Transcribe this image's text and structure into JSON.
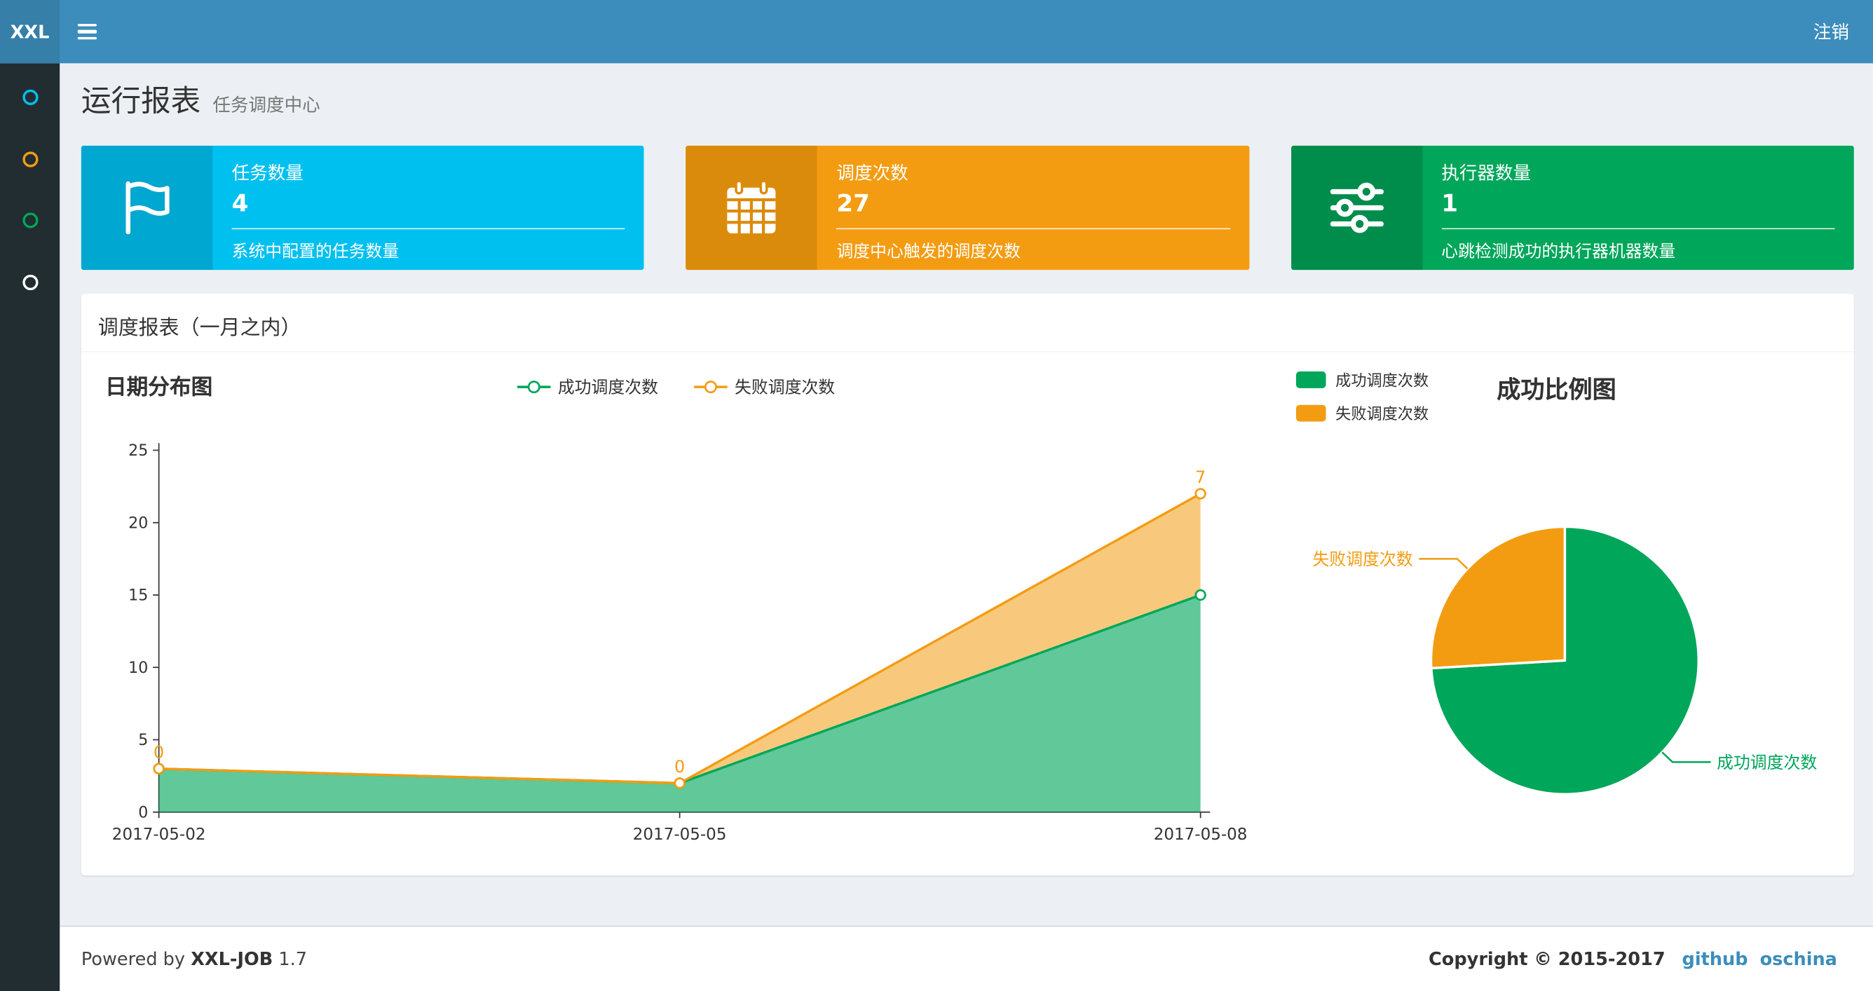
{
  "navbar": {
    "logo": "XXL",
    "menu_icon": "hamburger-icon",
    "logout": "注销"
  },
  "sidebar": {
    "items": [
      {
        "icon": "circle-outline-icon",
        "color": "#00c0ef"
      },
      {
        "icon": "circle-outline-icon",
        "color": "#f39c12"
      },
      {
        "icon": "circle-outline-icon",
        "color": "#00a65a"
      },
      {
        "icon": "circle-outline-icon",
        "color": "#ffffff"
      }
    ]
  },
  "page": {
    "title": "运行报表",
    "subtitle": "任务调度中心"
  },
  "stats": [
    {
      "label": "任务数量",
      "value": "4",
      "desc": "系统中配置的任务数量",
      "bg": "#00c0ef",
      "icon_bg": "#00a7d0",
      "icon": "flag-icon"
    },
    {
      "label": "调度次数",
      "value": "27",
      "desc": "调度中心触发的调度次数",
      "bg": "#f39c12",
      "icon_bg": "#db8b0b",
      "icon": "calendar-icon"
    },
    {
      "label": "执行器数量",
      "value": "1",
      "desc": "心跳检测成功的执行器机器数量",
      "bg": "#00a65a",
      "icon_bg": "#008d4c",
      "icon": "sliders-icon"
    }
  ],
  "panel": {
    "title": "调度报表（一月之内）"
  },
  "chart_data": [
    {
      "type": "area",
      "title": "日期分布图",
      "categories": [
        "2017-05-02",
        "2017-05-05",
        "2017-05-08"
      ],
      "series": [
        {
          "name": "成功调度次数",
          "values": [
            3,
            2,
            15
          ],
          "color": "#00a65a"
        },
        {
          "name": "失败调度次数",
          "values": [
            0,
            0,
            7
          ],
          "color": "#f39c12"
        }
      ],
      "stacked": true,
      "ylim": [
        0,
        25
      ],
      "yticks": [
        0,
        5,
        10,
        15,
        20,
        25
      ],
      "point_labels": [
        "0",
        "0",
        "7"
      ],
      "legend_position": "top",
      "grid": false
    },
    {
      "type": "pie",
      "title": "成功比例图",
      "slices": [
        {
          "name": "成功调度次数",
          "value": 20,
          "color": "#00a65a"
        },
        {
          "name": "失败调度次数",
          "value": 7,
          "color": "#f39c12"
        }
      ],
      "legend_position": "top-left"
    }
  ],
  "footer": {
    "powered_prefix": "Powered by",
    "powered_brand": "XXL-JOB",
    "powered_version": "1.7",
    "copyright": "Copyright © 2015-2017",
    "links": [
      "github",
      "oschina"
    ]
  }
}
